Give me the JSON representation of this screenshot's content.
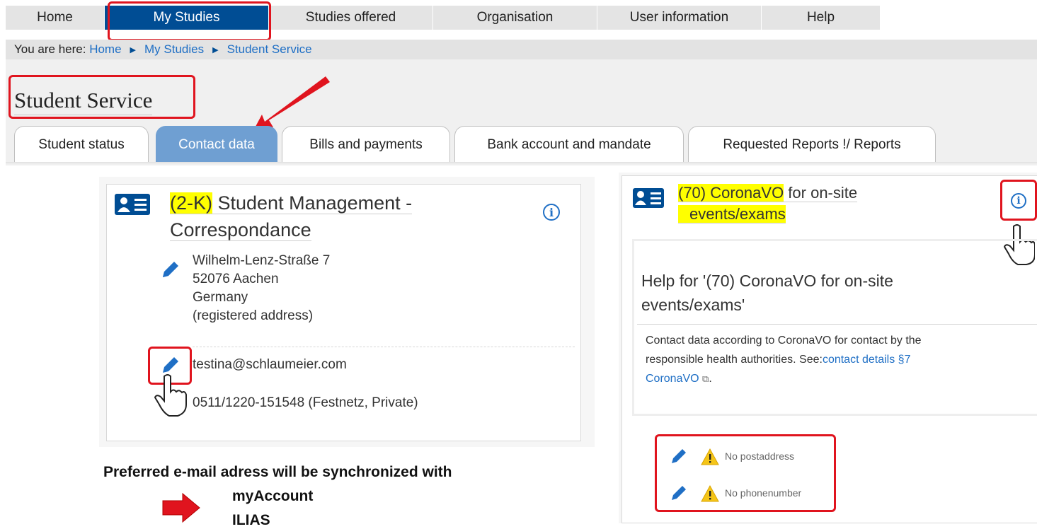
{
  "nav": {
    "items": [
      "Home",
      "My Studies",
      "Studies offered",
      "Organisation",
      "User information",
      "Help"
    ]
  },
  "breadcrumb": {
    "prefix": "You are here:",
    "items": [
      "Home",
      "My Studies",
      "Student Service"
    ]
  },
  "page": {
    "title": "Student Service"
  },
  "tabs": [
    "Student status",
    "Contact data",
    "Bills and payments",
    "Bank account and mandate",
    "Requested Reports !/ Reports"
  ],
  "left_card": {
    "title_code": "(2-K)",
    "title_line1": " Student Management -",
    "title_line2": "Correspondance",
    "address": [
      "Wilhelm-Lenz-Straße 7",
      "52076 Aachen",
      "Germany",
      "(registered address)"
    ],
    "email": "testina@schlaumeier.com",
    "phone": "0511/1220-151548 (Festnetz, Private)"
  },
  "right_card": {
    "title_code": "(70) CoronaVO",
    "title_rest": " for on-site",
    "title_line2": "events/exams",
    "help_title_line1": "Help for '(70) CoronaVO for on-site",
    "help_title_line2": "events/exams'",
    "help_text_1": "Contact data according to CoronaVO for contact by the",
    "help_text_2": "responsible health authorities. See:",
    "help_link_a": "contact details §7",
    "help_link_b": "CoronaVO",
    "help_text_end": ".",
    "no_post": "No postaddress",
    "no_phone": "No phonenumber"
  },
  "note": {
    "line1": "Preferred e-mail adress will be synchronized with",
    "line2": "myAccount",
    "line3": "ILIAS"
  },
  "colors": {
    "nav_active": "#004d94",
    "tab_active": "#6f9fd2",
    "highlight": "#ffff00",
    "annotation": "#e0141e",
    "link": "#1f6fc5"
  }
}
